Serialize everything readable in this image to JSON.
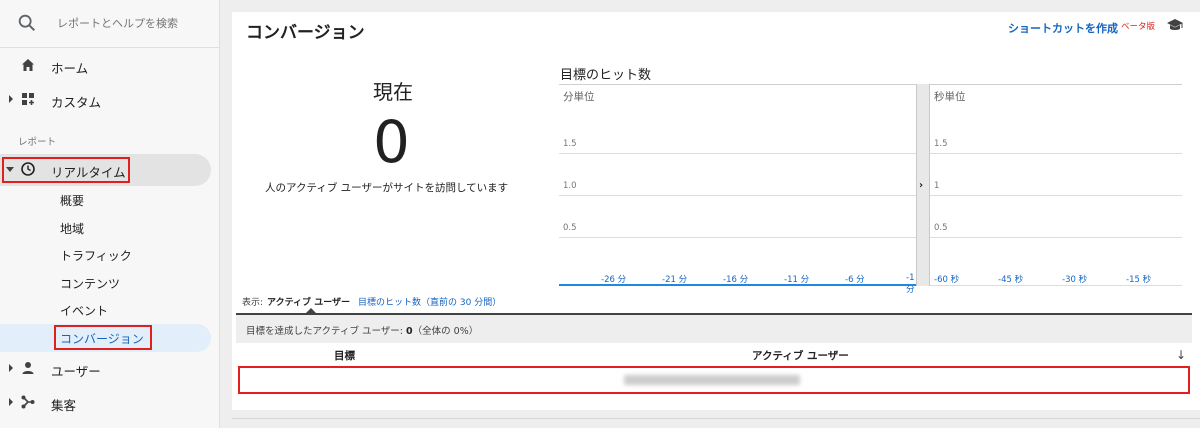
{
  "search": {
    "placeholder": "レポートとヘルプを検索",
    "icon": "search-icon"
  },
  "nav": {
    "home": {
      "label": "ホーム",
      "icon": "home-icon"
    },
    "custom": {
      "label": "カスタム",
      "icon": "dashboard-icon"
    },
    "section_label": "レポート",
    "realtime": {
      "label": "リアルタイム",
      "icon": "clock-icon",
      "expanded": true
    },
    "realtime_items": [
      "概要",
      "地域",
      "トラフィック",
      "コンテンツ",
      "イベント",
      "コンバージョン"
    ],
    "active_item": "コンバージョン",
    "audience": {
      "label": "ユーザー",
      "icon": "person-icon"
    },
    "acquisition": {
      "label": "集客",
      "icon": "acquisition-icon"
    }
  },
  "header": {
    "title": "コンバージョン",
    "shortcut_label": "ショートカットを作成",
    "beta_label": "ベータ版",
    "cap_icon": "graduation-cap-icon"
  },
  "current": {
    "label": "現在",
    "value": "0",
    "description": "人のアクティブ ユーザーがサイトを訪問しています"
  },
  "chart_data": [
    {
      "type": "line",
      "title": "目標のヒット数",
      "subtitle": "分単位",
      "x": [
        "-26 分",
        "-21 分",
        "-16 分",
        "-11 分",
        "-6 分",
        "-1 分"
      ],
      "y_ticks": [
        "1.5",
        "1.0",
        "0.5"
      ],
      "series": [
        {
          "values": [
            0,
            0,
            0,
            0,
            0,
            0
          ]
        }
      ],
      "ylim": [
        0,
        2
      ]
    },
    {
      "type": "line",
      "subtitle": "秒単位",
      "x": [
        "-60 秒",
        "-45 秒",
        "-30 秒",
        "-15 秒"
      ],
      "y_ticks": [
        "1.5",
        "1",
        "0.5"
      ],
      "series": [
        {
          "values": [
            0,
            0,
            0,
            0
          ]
        }
      ],
      "ylim": [
        0,
        2
      ]
    }
  ],
  "view": {
    "label": "表示:",
    "active_tab": "アクティブ ユーザー",
    "other_tab": "目標のヒット数（直前の 30 分間）"
  },
  "summary": {
    "prefix": "目標を達成したアクティブ ユーザー:",
    "value": "0",
    "suffix": "（全体の 0%）"
  },
  "table": {
    "headers": [
      "目標",
      "アクティブ ユーザー"
    ],
    "sort_icon": "arrow-down-icon"
  },
  "colors": {
    "accent": "#1565c0",
    "highlight": "#e0201c",
    "active_bg": "#e3eefb",
    "chart_line": "#1e88e5"
  }
}
